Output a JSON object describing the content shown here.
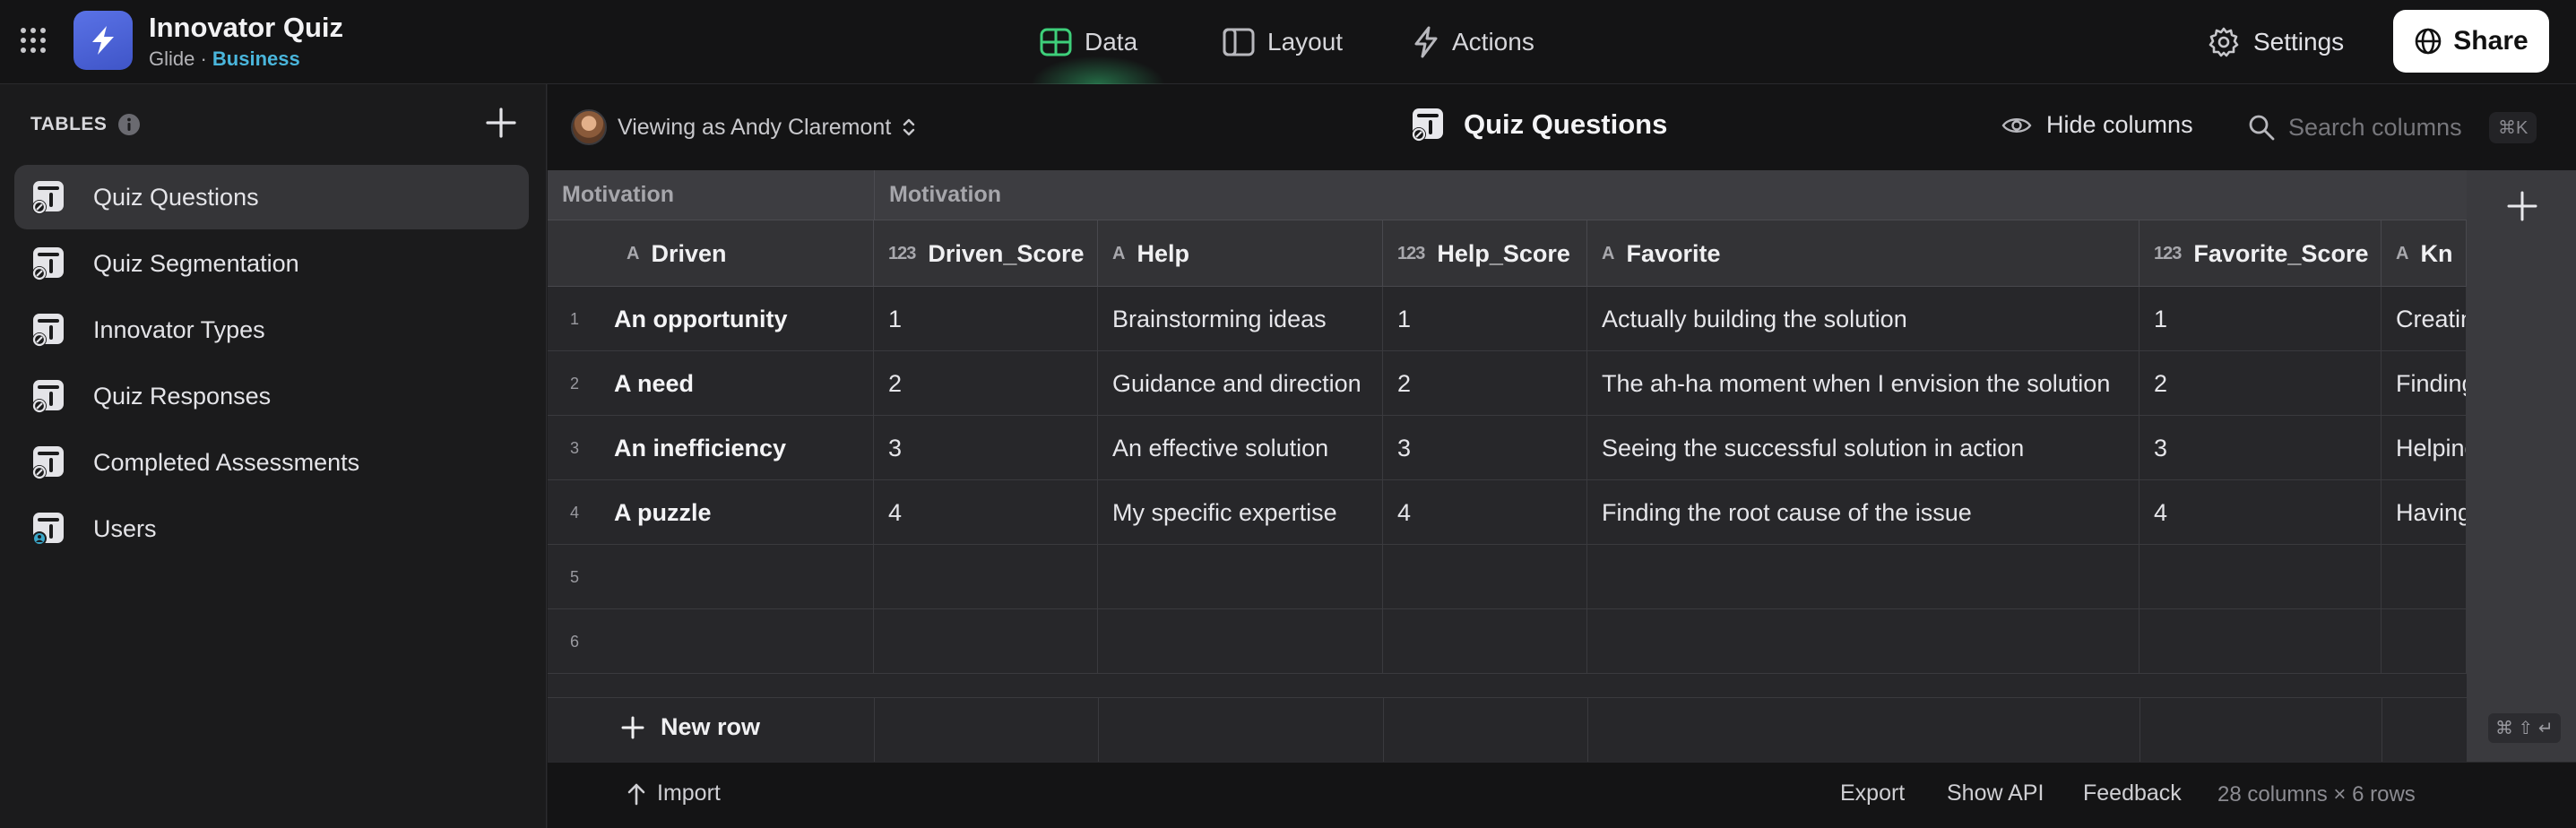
{
  "app": {
    "title": "Innovator Quiz",
    "platform": "Glide",
    "separator": " · ",
    "plan": "Business"
  },
  "nav": {
    "data": "Data",
    "layout": "Layout",
    "actions": "Actions",
    "settings": "Settings",
    "share": "Share"
  },
  "sidebar": {
    "header": "TABLES",
    "items": [
      {
        "label": "Quiz Questions",
        "active": true
      },
      {
        "label": "Quiz Segmentation"
      },
      {
        "label": "Innovator Types"
      },
      {
        "label": "Quiz Responses"
      },
      {
        "label": "Completed Assessments"
      },
      {
        "label": "Users"
      }
    ]
  },
  "subheader": {
    "viewing_as": "Viewing as Andy Claremont",
    "table_title": "Quiz Questions",
    "hide_columns": "Hide columns",
    "search_placeholder": "Search columns",
    "search_shortcut": "⌘K"
  },
  "grid": {
    "groups": [
      "Motivation",
      "Motivation"
    ],
    "columns": [
      {
        "type_icon": "A",
        "label": "Driven"
      },
      {
        "type_icon": "123",
        "label": "Driven_Score"
      },
      {
        "type_icon": "A",
        "label": "Help"
      },
      {
        "type_icon": "123",
        "label": "Help_Score"
      },
      {
        "type_icon": "A",
        "label": "Favorite"
      },
      {
        "type_icon": "123",
        "label": "Favorite_Score"
      },
      {
        "type_icon": "A",
        "label": "Kn"
      }
    ],
    "rows": [
      {
        "num": "1",
        "cells": [
          "An opportunity",
          "1",
          "Brainstorming ideas",
          "1",
          "Actually building the solution",
          "1",
          "Creatin"
        ]
      },
      {
        "num": "2",
        "cells": [
          "A need",
          "2",
          "Guidance and direction",
          "2",
          "The ah-ha moment when I envision the solution",
          "2",
          "Finding"
        ]
      },
      {
        "num": "3",
        "cells": [
          "An inefficiency",
          "3",
          "An effective solution",
          "3",
          "Seeing the successful solution in action",
          "3",
          "Helping"
        ]
      },
      {
        "num": "4",
        "cells": [
          "A puzzle",
          "4",
          "My specific expertise",
          "4",
          "Finding the root cause of the issue",
          "4",
          "Having"
        ]
      },
      {
        "num": "5",
        "cells": [
          "",
          "",
          "",
          "",
          "",
          "",
          ""
        ]
      },
      {
        "num": "6",
        "cells": [
          "",
          "",
          "",
          "",
          "",
          "",
          ""
        ]
      }
    ],
    "new_row": "New row",
    "keyboard_hint": "⌘ ⇧ ↵"
  },
  "footer": {
    "import": "Import",
    "export": "Export",
    "show_api": "Show API",
    "feedback": "Feedback",
    "count": "28 columns × 6 rows"
  }
}
